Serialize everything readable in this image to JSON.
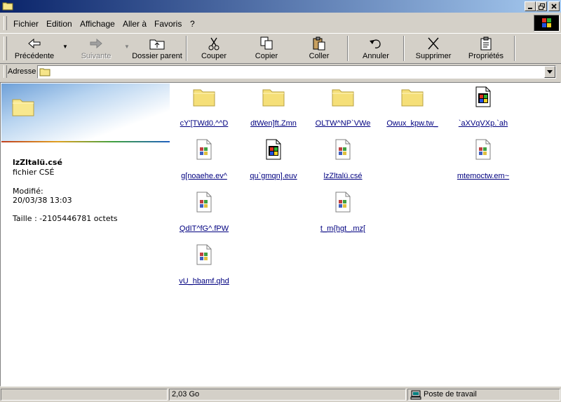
{
  "window": {
    "title": ""
  },
  "menu": [
    "Fichier",
    "Edition",
    "Affichage",
    "Aller à",
    "Favoris",
    "?"
  ],
  "toolbar": {
    "back": "Précédente",
    "forward": "Suivante",
    "up": "Dossier parent",
    "cut": "Couper",
    "copy": "Copier",
    "paste": "Coller",
    "undo": "Annuler",
    "delete": "Supprimer",
    "properties": "Propriétés"
  },
  "address": {
    "label": "Adresse",
    "value": ""
  },
  "details": {
    "name": "lzZltalü.csé",
    "type": "fichier CSÉ",
    "modified_label": "Modifié:",
    "modified_value": "20/03/38 13:03",
    "size": "Taille : -2105446781 octets"
  },
  "files": [
    {
      "name": "cY'[TWd0.^^D",
      "kind": "folder"
    },
    {
      "name": "dtWen]ft.Zmn",
      "kind": "folder"
    },
    {
      "name": "OLTW^NP`VWe",
      "kind": "folder"
    },
    {
      "name": "Owux_kpw.tw_",
      "kind": "folder"
    },
    {
      "name": "`aXVqVXp.`ah",
      "kind": "exe"
    },
    {
      "name": "g[noaehe.ev^",
      "kind": "generic"
    },
    {
      "name": "qu`gmqn].euv",
      "kind": "exe"
    },
    {
      "name": "lzZltalü.csé",
      "kind": "generic"
    },
    {
      "name": "mtemoctw.em~",
      "kind": "generic"
    },
    {
      "name": "QdIT^fG^.fPW",
      "kind": "generic"
    },
    {
      "name": "t_m{hgt_.mz[",
      "kind": "generic"
    },
    {
      "name": "vU_hbamf.qhd",
      "kind": "generic"
    }
  ],
  "status": {
    "left": "",
    "size": "2,03 Go",
    "zone": "Poste de travail"
  },
  "colors": {
    "titlebar_start": "#0a246a",
    "titlebar_end": "#a6caf0",
    "link": "#000080",
    "face": "#d4d0c8"
  }
}
